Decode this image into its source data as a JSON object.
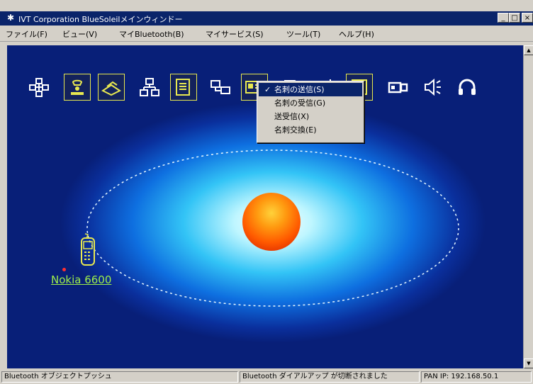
{
  "window": {
    "app_icon": "✱",
    "title": "IVT Corporation BlueSoleilメインウィンドー",
    "controls": {
      "minimize": "_",
      "maximize": "□",
      "close": "×"
    }
  },
  "menubar": {
    "items": [
      {
        "label": "ファイル(F)"
      },
      {
        "label": "ビュー(V)"
      },
      {
        "label": "マイBluetooth(B)"
      },
      {
        "label": "マイサービス(S)"
      },
      {
        "label": "ツール(T)"
      },
      {
        "label": "ヘルプ(H)"
      }
    ]
  },
  "services": [
    {
      "name": "network-access-icon",
      "framed": false
    },
    {
      "name": "dialup-networking-icon",
      "framed": true
    },
    {
      "name": "fax-icon",
      "framed": true
    },
    {
      "name": "lan-access-icon",
      "framed": false
    },
    {
      "name": "file-transfer-icon",
      "framed": true
    },
    {
      "name": "pan-icon",
      "framed": false
    },
    {
      "name": "business-card-icon",
      "framed": true
    },
    {
      "name": "sync-icon",
      "framed": false
    },
    {
      "name": "printer-icon",
      "framed": false
    },
    {
      "name": "serial-port-icon",
      "framed": true
    },
    {
      "name": "camera-icon",
      "framed": false
    },
    {
      "name": "audio-icon",
      "framed": false
    },
    {
      "name": "headset-icon",
      "framed": false
    }
  ],
  "context_menu": {
    "items": [
      {
        "label": "名刺の送信(S)",
        "checked": true,
        "selected": true
      },
      {
        "label": "名刺の受信(G)",
        "checked": false,
        "selected": false
      },
      {
        "label": "送受信(X)",
        "checked": false,
        "selected": false
      },
      {
        "label": "名刺交換(E)",
        "checked": false,
        "selected": false
      }
    ],
    "check_glyph": "✓"
  },
  "device": {
    "name": "Nokia 6600",
    "icon": "mobile-phone-icon"
  },
  "statusbar": {
    "left": "Bluetooth オブジェクトプッシュ",
    "middle": "Bluetooth ダイアルアップ が切断されました",
    "right": "PAN IP: 192.168.50.1"
  },
  "colors": {
    "titlebar": "#0a246a",
    "device_label": "#9ff04a",
    "service_frame": "#e8e850"
  }
}
